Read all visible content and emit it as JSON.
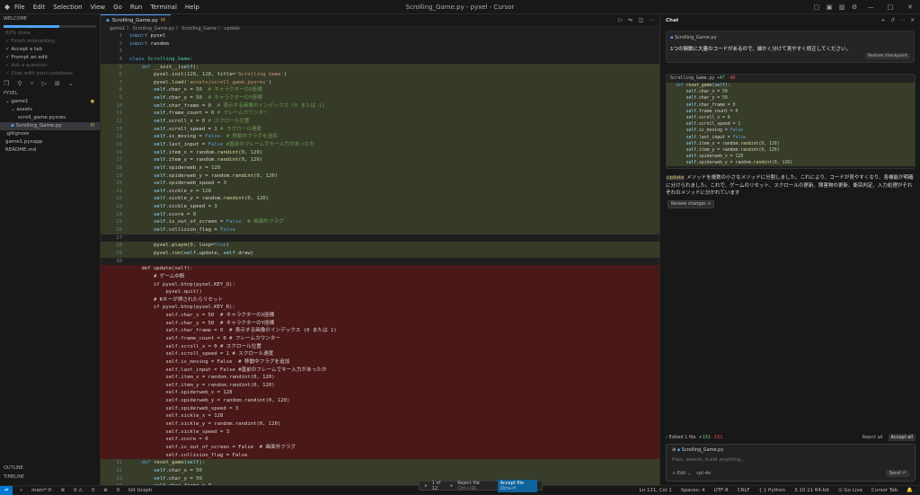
{
  "titlebar": {
    "menu": [
      "File",
      "Edit",
      "Selection",
      "View",
      "Go",
      "Run",
      "Terminal",
      "Help"
    ],
    "title": "Scrolling_Game.py - pyxel - Cursor"
  },
  "sidebar": {
    "welcome": "WELCOME",
    "progress_label": "60% done",
    "progress": 0.6,
    "checklist": [
      "Finish onboarding",
      "Accept a tab",
      "Prompt an edit",
      "Ask a question",
      "Chat with your codebase"
    ],
    "explorer": "PYXEL",
    "folder": "game1",
    "subfolder": "assets",
    "files": [
      "scroll_game.pyxres",
      "Scrolling_Game.py"
    ],
    "root_files": [
      ".gitignore",
      "game1.pyxapp",
      "README.md"
    ],
    "file_mod": "M",
    "outline": "OUTLINE",
    "timeline": "TIMELINE"
  },
  "editor": {
    "tab": "Scrolling_Game.py",
    "tab_mod": "M",
    "breadcrumb": "game1 〉 Scrolling_Game.py 〉 Scrolling_Game 〉 update",
    "review": {
      "count": "1 of 12",
      "reject": "Reject file",
      "reject_key": "Ctrl+⌫",
      "accept": "Accept file",
      "accept_key": "Ctrl+⏎"
    }
  },
  "chat": {
    "title": "Chat",
    "msg_file": "Scrolling_Game.py",
    "msg": "1つの関数に大量のコードがあるので、細かく分けて見やすく修正してください。",
    "restore": "Restore checkpoint",
    "diff_file": "Scrolling_Game.py",
    "diff_add": "+47",
    "diff_del": "-48",
    "summary_code": "update",
    "summary": " メソッドを複数の小さなメソッドに分割しました。これにより、コードが見やすくなり、各機能が明確に分けられました。これで、ゲームのリセット、スクロールの更新、障害物の更新、衝突判定、入力処理がそれぞれのメソッドに分かれています",
    "review_changes": "Review changes",
    "edited": "Edited 1 file",
    "edited_add": "+151",
    "edited_del": "-151",
    "reject_all": "Reject all",
    "accept_all": "Accept all",
    "input_ctx": "Scrolling_Game.py",
    "placeholder": "Plan, search, build anything...",
    "mode": "Edit",
    "model": "cpt-4o",
    "send": "Send"
  },
  "status": {
    "branch": "main*",
    "errors": "0",
    "warnings": "0",
    "ports": "0",
    "git": "Git Graph",
    "pos": "Ln 121, Col 1",
    "spaces": "Spaces: 4",
    "enc": "UTF-8",
    "eol": "CRLF",
    "lang": "Python",
    "ver": "3.10.11 64-bit",
    "live": "Go Live",
    "tab": "Cursor Tab"
  }
}
